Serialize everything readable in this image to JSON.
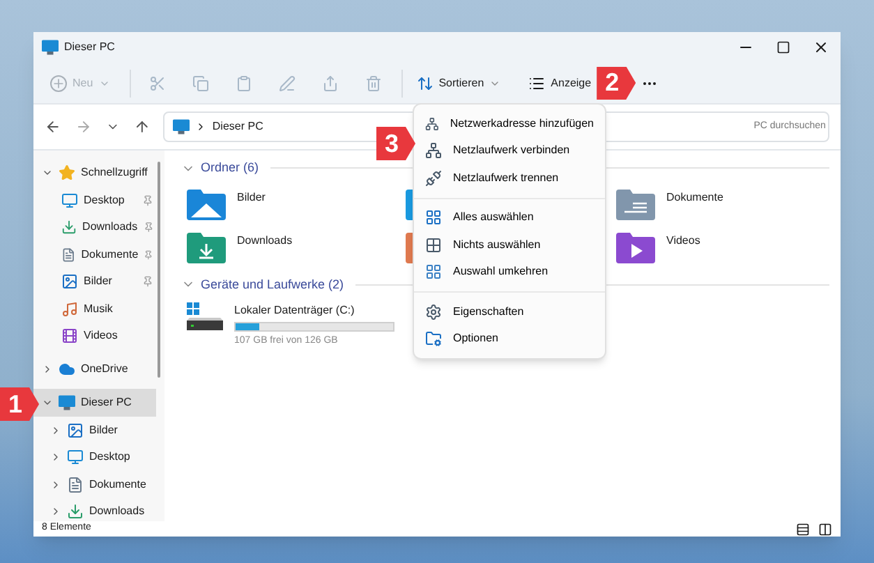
{
  "window": {
    "title": "Dieser PC"
  },
  "toolbar": {
    "new": {
      "label": "Neu",
      "disabled": true
    },
    "sort": {
      "label": "Sortieren"
    },
    "view": {
      "label": "Anzeige"
    }
  },
  "address": {
    "path": "Dieser PC",
    "search_placeholder": "PC durchsuchen"
  },
  "sidebar": {
    "items": [
      {
        "label": "Schnellzugriff",
        "expanded": true,
        "selected": false,
        "children": [
          {
            "label": "Desktop",
            "pinned": true
          },
          {
            "label": "Downloads",
            "pinned": true
          },
          {
            "label": "Dokumente",
            "pinned": true
          },
          {
            "label": "Bilder",
            "pinned": true
          },
          {
            "label": "Musik",
            "pinned": false
          },
          {
            "label": "Videos",
            "pinned": false
          }
        ]
      },
      {
        "label": "OneDrive",
        "expanded": false,
        "selected": false
      },
      {
        "label": "Dieser PC",
        "expanded": true,
        "selected": true,
        "children": [
          {
            "label": "Bilder",
            "pinned": false
          },
          {
            "label": "Desktop",
            "pinned": false
          },
          {
            "label": "Dokumente",
            "pinned": false
          },
          {
            "label": "Downloads",
            "pinned": false
          }
        ]
      }
    ]
  },
  "folders": {
    "header": "Ordner (6)",
    "expanded": true,
    "items": [
      {
        "label": "Bilder",
        "kind": "pictures"
      },
      {
        "kind": "desktop"
      },
      {
        "label": "Dokumente",
        "kind": "documents"
      },
      {
        "label": "Downloads",
        "kind": "downloads"
      },
      {
        "kind": "music"
      },
      {
        "label": "Videos",
        "kind": "videos"
      }
    ]
  },
  "drives": {
    "header": "Geräte und Laufwerke (2)",
    "expanded": true,
    "items": [
      {
        "label": "Lokaler Datenträger (C:)",
        "level": 0.15,
        "free": "107 GB frei von 126 GB"
      }
    ]
  },
  "menu": {
    "groups": [
      [
        "Netzwerkadresse hinzufügen",
        "Netzlaufwerk verbinden",
        "Netzlaufwerk trennen"
      ],
      [
        "Alles auswählen",
        "Nichts auswählen",
        "Auswahl umkehren"
      ],
      [
        "Eigenschaften",
        "Optionen"
      ]
    ]
  },
  "status_bar": {
    "count": "8 Elemente"
  },
  "callouts": [
    "1",
    "2",
    "3"
  ]
}
